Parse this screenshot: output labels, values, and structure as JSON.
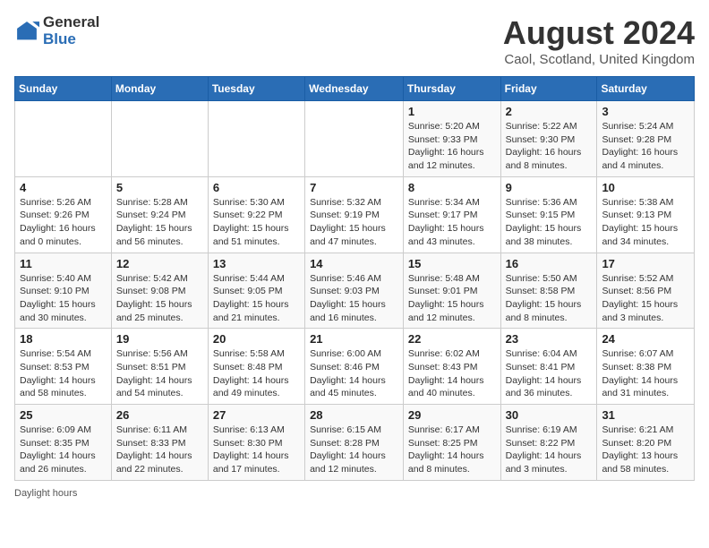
{
  "logo": {
    "general": "General",
    "blue": "Blue"
  },
  "title": "August 2024",
  "subtitle": "Caol, Scotland, United Kingdom",
  "days_of_week": [
    "Sunday",
    "Monday",
    "Tuesday",
    "Wednesday",
    "Thursday",
    "Friday",
    "Saturday"
  ],
  "footer": "Daylight hours",
  "weeks": [
    [
      {
        "day": "",
        "info": ""
      },
      {
        "day": "",
        "info": ""
      },
      {
        "day": "",
        "info": ""
      },
      {
        "day": "",
        "info": ""
      },
      {
        "day": "1",
        "info": "Sunrise: 5:20 AM\nSunset: 9:33 PM\nDaylight: 16 hours and 12 minutes."
      },
      {
        "day": "2",
        "info": "Sunrise: 5:22 AM\nSunset: 9:30 PM\nDaylight: 16 hours and 8 minutes."
      },
      {
        "day": "3",
        "info": "Sunrise: 5:24 AM\nSunset: 9:28 PM\nDaylight: 16 hours and 4 minutes."
      }
    ],
    [
      {
        "day": "4",
        "info": "Sunrise: 5:26 AM\nSunset: 9:26 PM\nDaylight: 16 hours and 0 minutes."
      },
      {
        "day": "5",
        "info": "Sunrise: 5:28 AM\nSunset: 9:24 PM\nDaylight: 15 hours and 56 minutes."
      },
      {
        "day": "6",
        "info": "Sunrise: 5:30 AM\nSunset: 9:22 PM\nDaylight: 15 hours and 51 minutes."
      },
      {
        "day": "7",
        "info": "Sunrise: 5:32 AM\nSunset: 9:19 PM\nDaylight: 15 hours and 47 minutes."
      },
      {
        "day": "8",
        "info": "Sunrise: 5:34 AM\nSunset: 9:17 PM\nDaylight: 15 hours and 43 minutes."
      },
      {
        "day": "9",
        "info": "Sunrise: 5:36 AM\nSunset: 9:15 PM\nDaylight: 15 hours and 38 minutes."
      },
      {
        "day": "10",
        "info": "Sunrise: 5:38 AM\nSunset: 9:13 PM\nDaylight: 15 hours and 34 minutes."
      }
    ],
    [
      {
        "day": "11",
        "info": "Sunrise: 5:40 AM\nSunset: 9:10 PM\nDaylight: 15 hours and 30 minutes."
      },
      {
        "day": "12",
        "info": "Sunrise: 5:42 AM\nSunset: 9:08 PM\nDaylight: 15 hours and 25 minutes."
      },
      {
        "day": "13",
        "info": "Sunrise: 5:44 AM\nSunset: 9:05 PM\nDaylight: 15 hours and 21 minutes."
      },
      {
        "day": "14",
        "info": "Sunrise: 5:46 AM\nSunset: 9:03 PM\nDaylight: 15 hours and 16 minutes."
      },
      {
        "day": "15",
        "info": "Sunrise: 5:48 AM\nSunset: 9:01 PM\nDaylight: 15 hours and 12 minutes."
      },
      {
        "day": "16",
        "info": "Sunrise: 5:50 AM\nSunset: 8:58 PM\nDaylight: 15 hours and 8 minutes."
      },
      {
        "day": "17",
        "info": "Sunrise: 5:52 AM\nSunset: 8:56 PM\nDaylight: 15 hours and 3 minutes."
      }
    ],
    [
      {
        "day": "18",
        "info": "Sunrise: 5:54 AM\nSunset: 8:53 PM\nDaylight: 14 hours and 58 minutes."
      },
      {
        "day": "19",
        "info": "Sunrise: 5:56 AM\nSunset: 8:51 PM\nDaylight: 14 hours and 54 minutes."
      },
      {
        "day": "20",
        "info": "Sunrise: 5:58 AM\nSunset: 8:48 PM\nDaylight: 14 hours and 49 minutes."
      },
      {
        "day": "21",
        "info": "Sunrise: 6:00 AM\nSunset: 8:46 PM\nDaylight: 14 hours and 45 minutes."
      },
      {
        "day": "22",
        "info": "Sunrise: 6:02 AM\nSunset: 8:43 PM\nDaylight: 14 hours and 40 minutes."
      },
      {
        "day": "23",
        "info": "Sunrise: 6:04 AM\nSunset: 8:41 PM\nDaylight: 14 hours and 36 minutes."
      },
      {
        "day": "24",
        "info": "Sunrise: 6:07 AM\nSunset: 8:38 PM\nDaylight: 14 hours and 31 minutes."
      }
    ],
    [
      {
        "day": "25",
        "info": "Sunrise: 6:09 AM\nSunset: 8:35 PM\nDaylight: 14 hours and 26 minutes."
      },
      {
        "day": "26",
        "info": "Sunrise: 6:11 AM\nSunset: 8:33 PM\nDaylight: 14 hours and 22 minutes."
      },
      {
        "day": "27",
        "info": "Sunrise: 6:13 AM\nSunset: 8:30 PM\nDaylight: 14 hours and 17 minutes."
      },
      {
        "day": "28",
        "info": "Sunrise: 6:15 AM\nSunset: 8:28 PM\nDaylight: 14 hours and 12 minutes."
      },
      {
        "day": "29",
        "info": "Sunrise: 6:17 AM\nSunset: 8:25 PM\nDaylight: 14 hours and 8 minutes."
      },
      {
        "day": "30",
        "info": "Sunrise: 6:19 AM\nSunset: 8:22 PM\nDaylight: 14 hours and 3 minutes."
      },
      {
        "day": "31",
        "info": "Sunrise: 6:21 AM\nSunset: 8:20 PM\nDaylight: 13 hours and 58 minutes."
      }
    ]
  ]
}
